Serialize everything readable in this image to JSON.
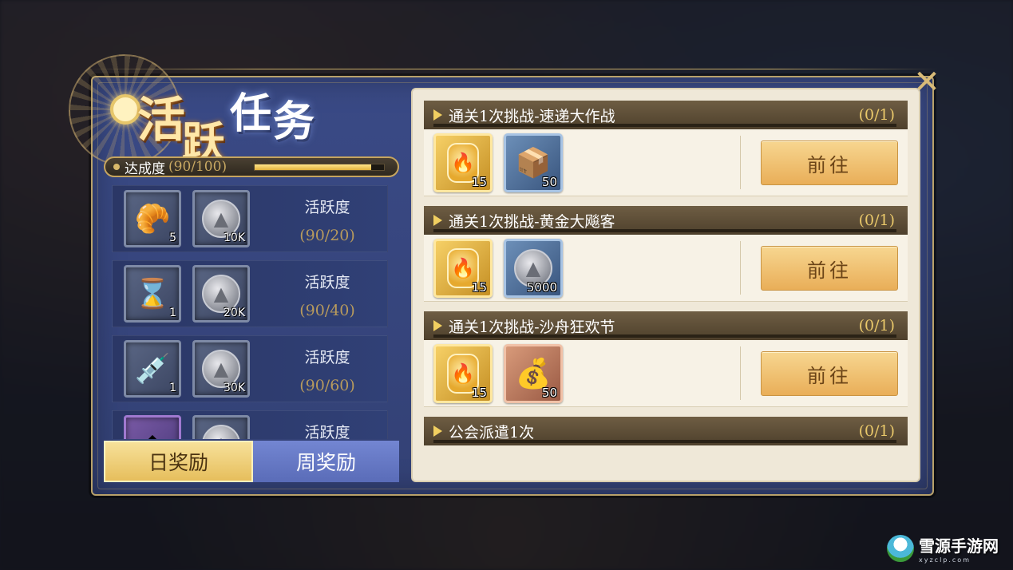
{
  "title": {
    "chars": [
      "活",
      "跃",
      "任",
      "务"
    ]
  },
  "progress": {
    "label": "达成度",
    "value_text": "(90/100)",
    "fraction": 0.9
  },
  "daily_rewards": [
    {
      "items": [
        {
          "icon": "croissant-icon",
          "glyph": "🥐",
          "count": "5"
        },
        {
          "icon": "silver-coin-icon",
          "glyph": "▲",
          "count": "10K"
        }
      ],
      "label": "活跃度",
      "value": "(90/20)"
    },
    {
      "items": [
        {
          "icon": "hourglass-icon",
          "glyph": "⌛",
          "count": "1"
        },
        {
          "icon": "silver-coin-icon",
          "glyph": "▲",
          "count": "20K"
        }
      ],
      "label": "活跃度",
      "value": "(90/40)"
    },
    {
      "items": [
        {
          "icon": "syringe-icon",
          "glyph": "💉",
          "count": "1"
        },
        {
          "icon": "silver-coin-icon",
          "glyph": "▲",
          "count": "30K"
        }
      ],
      "label": "活跃度",
      "value": "(90/60)"
    },
    {
      "items": [
        {
          "icon": "gem-icon",
          "glyph": "◆",
          "count": ""
        },
        {
          "icon": "silver-coin-icon",
          "glyph": "▲",
          "count": ""
        }
      ],
      "label": "活跃度",
      "value": ""
    }
  ],
  "tabs": {
    "daily": "日奖励",
    "weekly": "周奖励"
  },
  "tasks": [
    {
      "name": "通关1次挑战-速递大作战",
      "count": "(0/1)",
      "button": "前往",
      "rewards": [
        {
          "style": "gold",
          "icon": "flame-token-icon",
          "glyph": "🔥",
          "count": "15"
        },
        {
          "style": "blue",
          "icon": "wooden-crate-icon",
          "glyph": "📦",
          "count": "50"
        }
      ]
    },
    {
      "name": "通关1次挑战-黄金大飚客",
      "count": "(0/1)",
      "button": "前往",
      "rewards": [
        {
          "style": "gold",
          "icon": "flame-token-icon",
          "glyph": "🔥",
          "count": "15"
        },
        {
          "style": "blue",
          "icon": "silver-coin-icon",
          "glyph": "▲",
          "count": "5000"
        }
      ]
    },
    {
      "name": "通关1次挑战-沙舟狂欢节",
      "count": "(0/1)",
      "button": "前往",
      "rewards": [
        {
          "style": "gold",
          "icon": "flame-token-icon",
          "glyph": "🔥",
          "count": "15"
        },
        {
          "style": "orange",
          "icon": "money-bag-icon",
          "glyph": "💰",
          "count": "50"
        }
      ]
    },
    {
      "name": "公会派遣1次",
      "count": "(0/1)"
    }
  ],
  "close_glyph": "✕",
  "watermark": {
    "text": "雪源手游网",
    "sub": "xyzclp.com"
  }
}
